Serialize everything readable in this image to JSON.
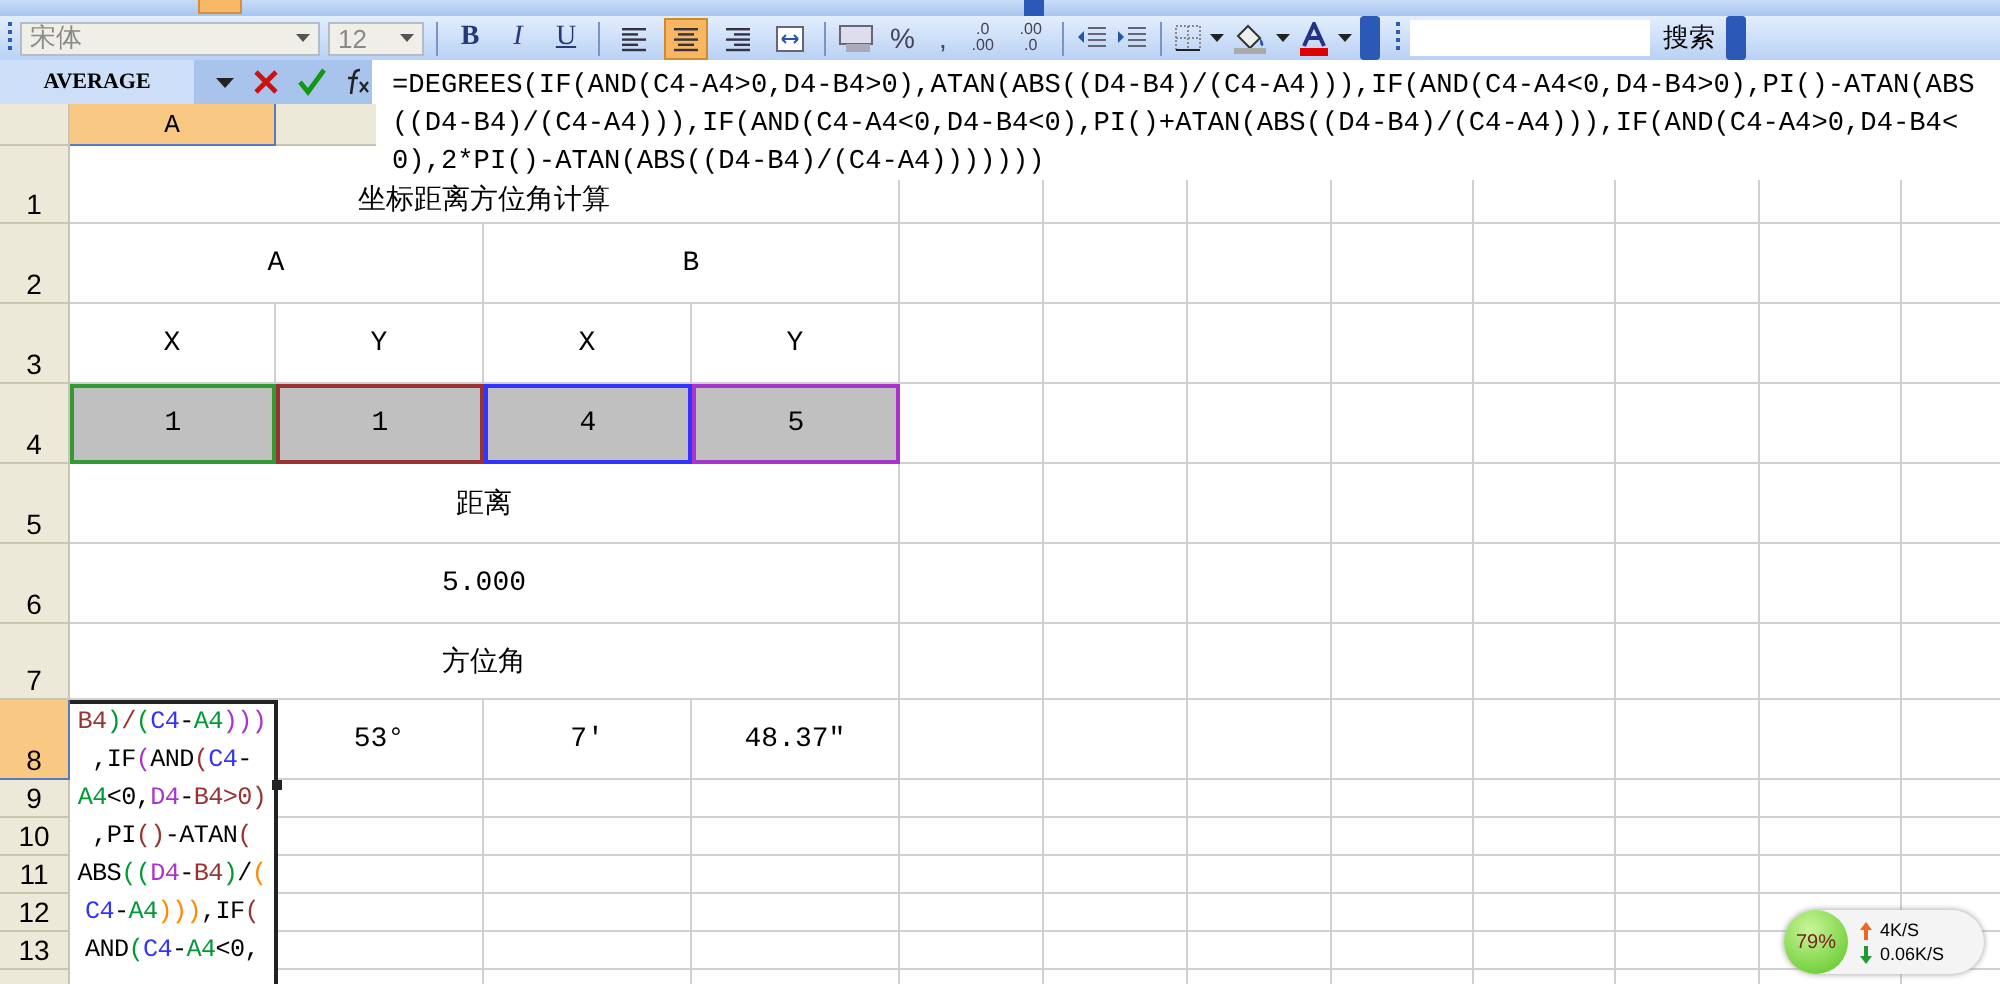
{
  "toolbar": {
    "font": "宋体",
    "size": "12",
    "format_buttons": [
      {
        "label": "B",
        "kind": "bold"
      },
      {
        "label": "I",
        "kind": "italic"
      },
      {
        "label": "U",
        "kind": "underline"
      }
    ],
    "align_buttons": [
      {
        "kind": "left",
        "selected": false
      },
      {
        "kind": "center",
        "selected": true
      },
      {
        "kind": "right",
        "selected": false
      },
      {
        "kind": "merge",
        "selected": false
      }
    ],
    "number_buttons": [
      {
        "label": "%"
      },
      {
        "label": ","
      }
    ],
    "decimal_buttons": [
      {
        "top": ".0",
        "bottom": ".00"
      },
      {
        "top": ".00",
        "bottom": ".0"
      }
    ],
    "search": {
      "button": "搜索"
    }
  },
  "formula_bar": {
    "name_box": "AVERAGE",
    "formula": "=DEGREES(IF(AND(C4-A4>0,D4-B4>0),ATAN(ABS((D4-B4)/(C4-A4))),IF(AND(C4-A4<0,D4-B4>0),PI()-ATAN(ABS((D4-B4)/(C4-A4))),IF(AND(C4-A4<0,D4-B4<0),PI()+ATAN(ABS((D4-B4)/(C4-A4))),IF(AND(C4-A4>0,D4-B4<0),2*PI()-ATAN(ABS((D4-B4)/(C4-A4)))))))"
  },
  "columns": [
    {
      "label": "A",
      "selected": true
    }
  ],
  "rows": [
    {
      "header": "1",
      "selected": false,
      "cells": [
        {
          "text": "坐标距离方位角计算"
        }
      ]
    },
    {
      "header": "2",
      "selected": false,
      "cells": [
        {
          "text": "A"
        },
        {
          "text": "B"
        }
      ]
    },
    {
      "header": "3",
      "selected": false,
      "cells": [
        {
          "text": "X"
        },
        {
          "text": "Y"
        },
        {
          "text": "X"
        },
        {
          "text": "Y"
        }
      ]
    },
    {
      "header": "4",
      "selected": false,
      "cells": [
        {
          "text": "1",
          "color": "#339933"
        },
        {
          "text": "1",
          "color": "#993333"
        },
        {
          "text": "4",
          "color": "#3333ff"
        },
        {
          "text": "5",
          "color": "#aa33cc"
        }
      ]
    },
    {
      "header": "5",
      "selected": false,
      "cells": [
        {
          "text": "距离"
        }
      ]
    },
    {
      "header": "6",
      "selected": false,
      "cells": [
        {
          "text": "5.000"
        }
      ]
    },
    {
      "header": "7",
      "selected": false,
      "cells": [
        {
          "text": "方位角"
        }
      ]
    },
    {
      "header": "8",
      "selected": true,
      "cells": [
        {
          "editing": true
        },
        {
          "text": "53°"
        },
        {
          "text": "7′"
        },
        {
          "text": "48.37″"
        }
      ]
    },
    {
      "header": "9",
      "selected": false,
      "cells": []
    },
    {
      "header": "10",
      "selected": false,
      "cells": []
    },
    {
      "header": "11",
      "selected": false,
      "cells": []
    },
    {
      "header": "12",
      "selected": false,
      "cells": []
    },
    {
      "header": "13",
      "selected": false,
      "cells": []
    }
  ],
  "edit_lines": [
    [
      {
        "text": "B4",
        "color": "#993333"
      },
      {
        "text": ")",
        "color": "#009933"
      },
      {
        "text": "/",
        "color": "#993333"
      },
      {
        "text": "(",
        "color": "#009933"
      },
      {
        "text": "C4",
        "color": "#3333ff"
      },
      {
        "text": "-",
        "color": "#000000"
      },
      {
        "text": "A4",
        "color": "#009933"
      },
      {
        "text": ")))",
        "color": "#aa33cc"
      }
    ],
    [
      {
        "text": ",IF",
        "color": "#000000"
      },
      {
        "text": "(",
        "color": "#aa33cc"
      },
      {
        "text": "AND",
        "color": "#000000"
      },
      {
        "text": "(",
        "color": "#993333"
      },
      {
        "text": "C4",
        "color": "#3333ff"
      },
      {
        "text": "-",
        "color": "#000000"
      }
    ],
    [
      {
        "text": "A4",
        "color": "#009933"
      },
      {
        "text": "<0,",
        "color": "#000000"
      },
      {
        "text": "D4",
        "color": "#aa33cc"
      },
      {
        "text": "-",
        "color": "#000000"
      },
      {
        "text": "B4",
        "color": "#993333"
      },
      {
        "text": ">0)",
        "color": "#993333"
      }
    ],
    [
      {
        "text": ",PI",
        "color": "#000000"
      },
      {
        "text": "()",
        "color": "#993333"
      },
      {
        "text": "-ATAN",
        "color": "#000000"
      },
      {
        "text": "(",
        "color": "#993333"
      }
    ],
    [
      {
        "text": "ABS",
        "color": "#000000"
      },
      {
        "text": "((",
        "color": "#009933"
      },
      {
        "text": "D4",
        "color": "#aa33cc"
      },
      {
        "text": "-",
        "color": "#000000"
      },
      {
        "text": "B4",
        "color": "#993333"
      },
      {
        "text": ")",
        "color": "#009933"
      },
      {
        "text": "/",
        "color": "#000000"
      },
      {
        "text": "(",
        "color": "#ff8800"
      }
    ],
    [
      {
        "text": "C4",
        "color": "#3333ff"
      },
      {
        "text": "-",
        "color": "#000000"
      },
      {
        "text": "A4",
        "color": "#009933"
      },
      {
        "text": ")))",
        "color": "#ff8800"
      },
      {
        "text": ",IF",
        "color": "#000000"
      },
      {
        "text": "(",
        "color": "#993333"
      }
    ],
    [
      {
        "text": "AND",
        "color": "#000000"
      },
      {
        "text": "(",
        "color": "#009933"
      },
      {
        "text": "C4",
        "color": "#3333ff"
      },
      {
        "text": "-",
        "color": "#000000"
      },
      {
        "text": "A4",
        "color": "#009933"
      },
      {
        "text": "<0,",
        "color": "#000000"
      }
    ]
  ],
  "speed_widget": {
    "percent": "79%",
    "up": "4K/S",
    "down": "0.06K/S"
  }
}
